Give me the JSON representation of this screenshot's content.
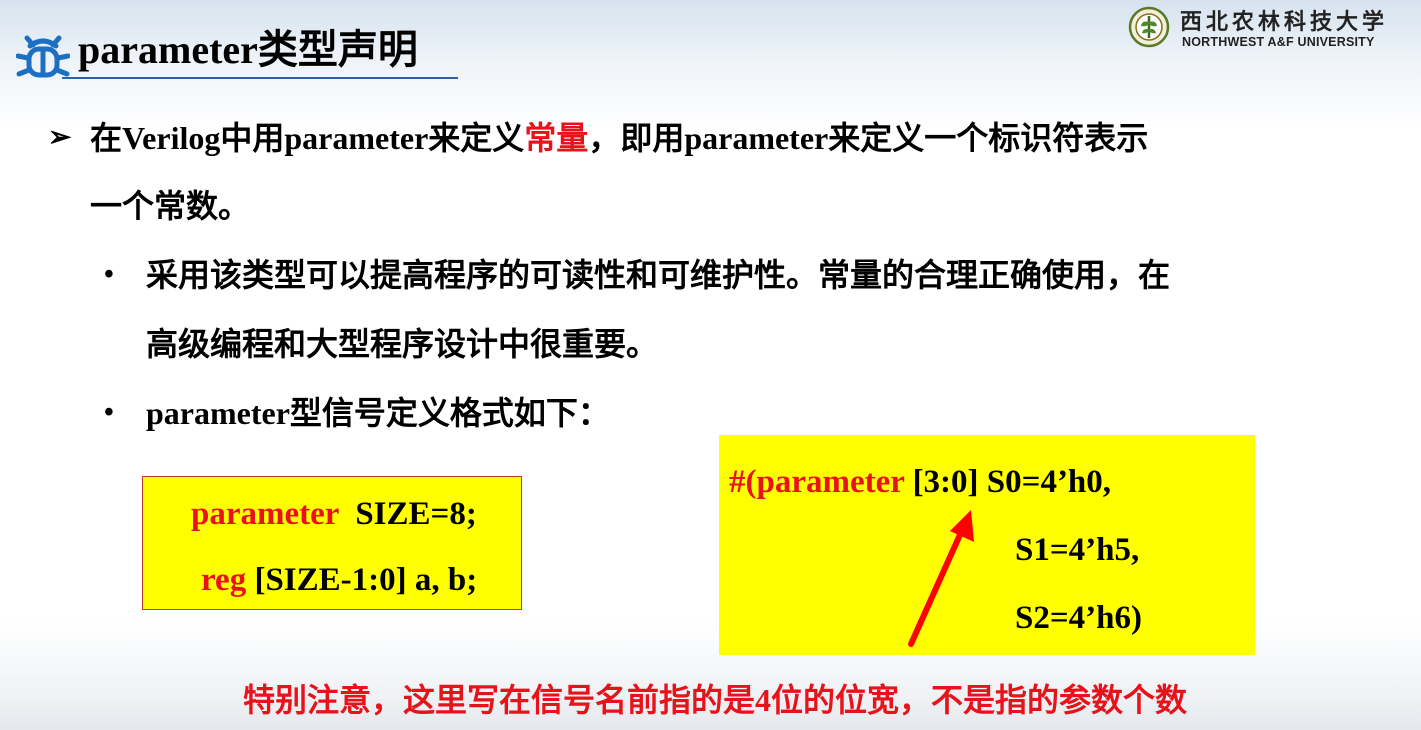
{
  "header": {
    "title": "parameter类型声明",
    "icon": "bug-icon",
    "logo_cn": "西北农林科技大学",
    "logo_en": "NORTHWEST A&F UNIVERSITY"
  },
  "content": {
    "p1_pre": "在Verilog中用parameter来定义",
    "p1_highlight": "常量",
    "p1_post": "，即用parameter来定义一个标识符表示",
    "p1_line2": "一个常数。",
    "b1_line1": "采用该类型可以提高程序的可读性和可维护性。常量的合理正确使用，在",
    "b1_line2": "高级编程和大型程序设计中很重要。",
    "b2": "parameter型信号定义格式如下：",
    "arrow_bullet": "➢",
    "dot_bullet": "•"
  },
  "code_left": {
    "line1_kw": "parameter",
    "line1_rest": "  SIZE=8;",
    "line2_kw": "reg",
    "line2_rest": " [SIZE-1:0] a, b;"
  },
  "code_right": {
    "line1_kw": "#(parameter",
    "line1_rest": " [3:0] S0=4’h0,",
    "line2": "S1=4’h5,",
    "line3": "S2=4’h6)"
  },
  "note": "特别注意，这里写在信号名前指的是4位的位宽，不是指的参数个数",
  "colors": {
    "keyword_red": "#e8131a",
    "box_yellow": "#ffff00",
    "title_underline": "#2e5fa8",
    "icon_blue": "#1d6fc4"
  }
}
